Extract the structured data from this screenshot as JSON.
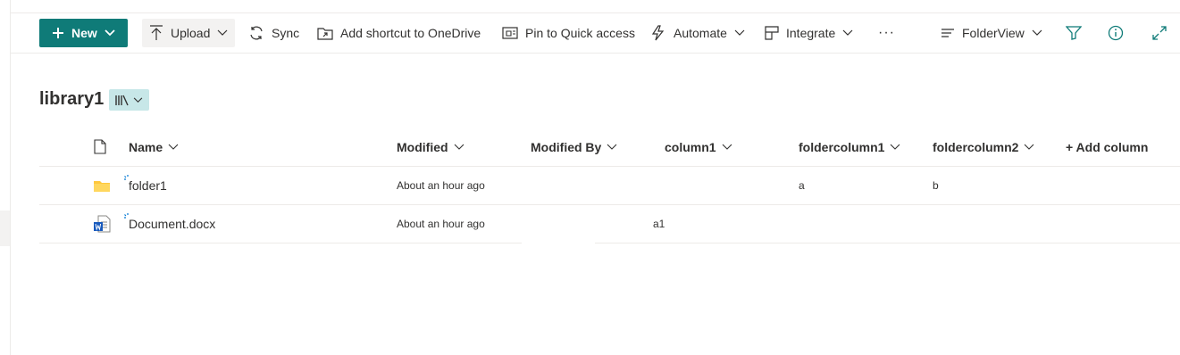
{
  "toolbar": {
    "new_label": "New",
    "upload_label": "Upload",
    "sync_label": "Sync",
    "shortcut_label": "Add shortcut to OneDrive",
    "pin_label": "Pin to Quick access",
    "automate_label": "Automate",
    "integrate_label": "Integrate",
    "more_label": "···",
    "view_label": "FolderView"
  },
  "library": {
    "title": "library1"
  },
  "columns": {
    "name": "Name",
    "modified": "Modified",
    "modified_by": "Modified By",
    "column1": "column1",
    "foldercolumn1": "foldercolumn1",
    "foldercolumn2": "foldercolumn2",
    "add_column": "+ Add column"
  },
  "rows": [
    {
      "name": "folder1",
      "modified": "About an hour ago",
      "modified_by": "",
      "column1": "",
      "foldercolumn1": "a",
      "foldercolumn2": "b"
    },
    {
      "name": "Document.docx",
      "modified": "About an hour ago",
      "modified_by": "",
      "column1": "a1",
      "foldercolumn1": "",
      "foldercolumn2": ""
    }
  ],
  "colors": {
    "accent": "#0f7b78",
    "view_button": "#c7e7e8",
    "folder": "#ffc83d",
    "word": "#185abd"
  }
}
